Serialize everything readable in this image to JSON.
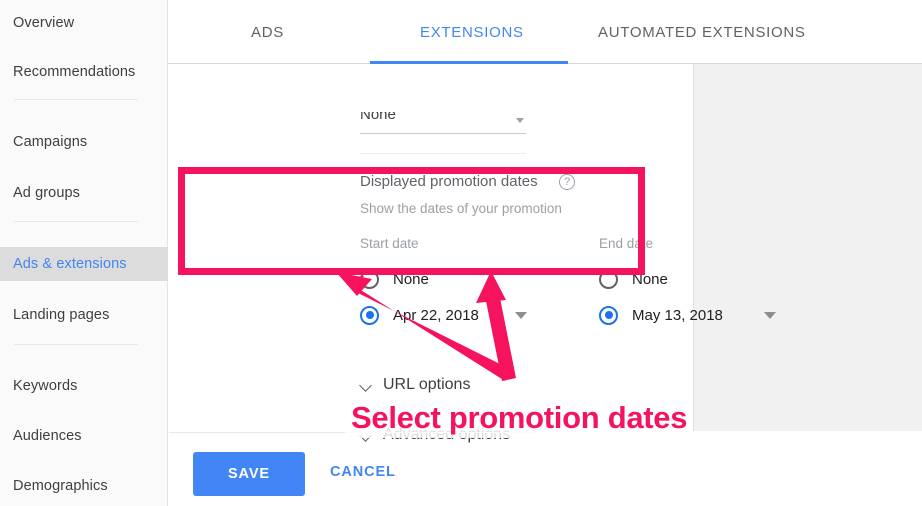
{
  "sidebar": {
    "items": [
      {
        "label": "Overview",
        "active": false
      },
      {
        "label": "Recommendations",
        "active": false
      },
      {
        "label": "Campaigns",
        "active": false
      },
      {
        "label": "Ad groups",
        "active": false
      },
      {
        "label": "Ads & extensions",
        "active": true
      },
      {
        "label": "Landing pages",
        "active": false
      },
      {
        "label": "Keywords",
        "active": false
      },
      {
        "label": "Audiences",
        "active": false
      },
      {
        "label": "Demographics",
        "active": false
      }
    ],
    "active_color": "#4285f4",
    "active_background": "#dcdcdc"
  },
  "tabs": [
    {
      "label": "ADS",
      "active": false
    },
    {
      "label": "EXTENSIONS",
      "active": true
    },
    {
      "label": "AUTOMATED EXTENSIONS",
      "active": false
    }
  ],
  "tab_accent_color": "#4285f4",
  "form": {
    "cutoff_field_value": "None",
    "section_label": "Displayed promotion dates",
    "help_icon": "help-circle-icon",
    "section_sublabel": "Show the dates of your promotion",
    "start": {
      "column_label": "Start date",
      "option_none": "None",
      "option_none_selected": false,
      "option_date": "Apr 22, 2018",
      "option_date_selected": true,
      "caret_icon": "chevron-down-icon"
    },
    "end": {
      "column_label": "End date",
      "option_none": "None",
      "option_none_selected": false,
      "option_date": "May 13, 2018",
      "option_date_selected": true,
      "caret_icon": "chevron-down-icon"
    },
    "expanders": [
      {
        "label": "URL options",
        "icon": "chevron-down-icon"
      },
      {
        "label": "Advanced options",
        "icon": "chevron-down-icon"
      }
    ],
    "radio_selected_color": "#1a73e8"
  },
  "actions": {
    "save_label": "SAVE",
    "cancel_label": "CANCEL",
    "save_background": "#4285f4",
    "cancel_color": "#4285f4"
  },
  "annotation": {
    "text": "Select promotion dates",
    "color": "#f5135e",
    "highlight_shape": "rectangle",
    "arrow_count": 2
  }
}
